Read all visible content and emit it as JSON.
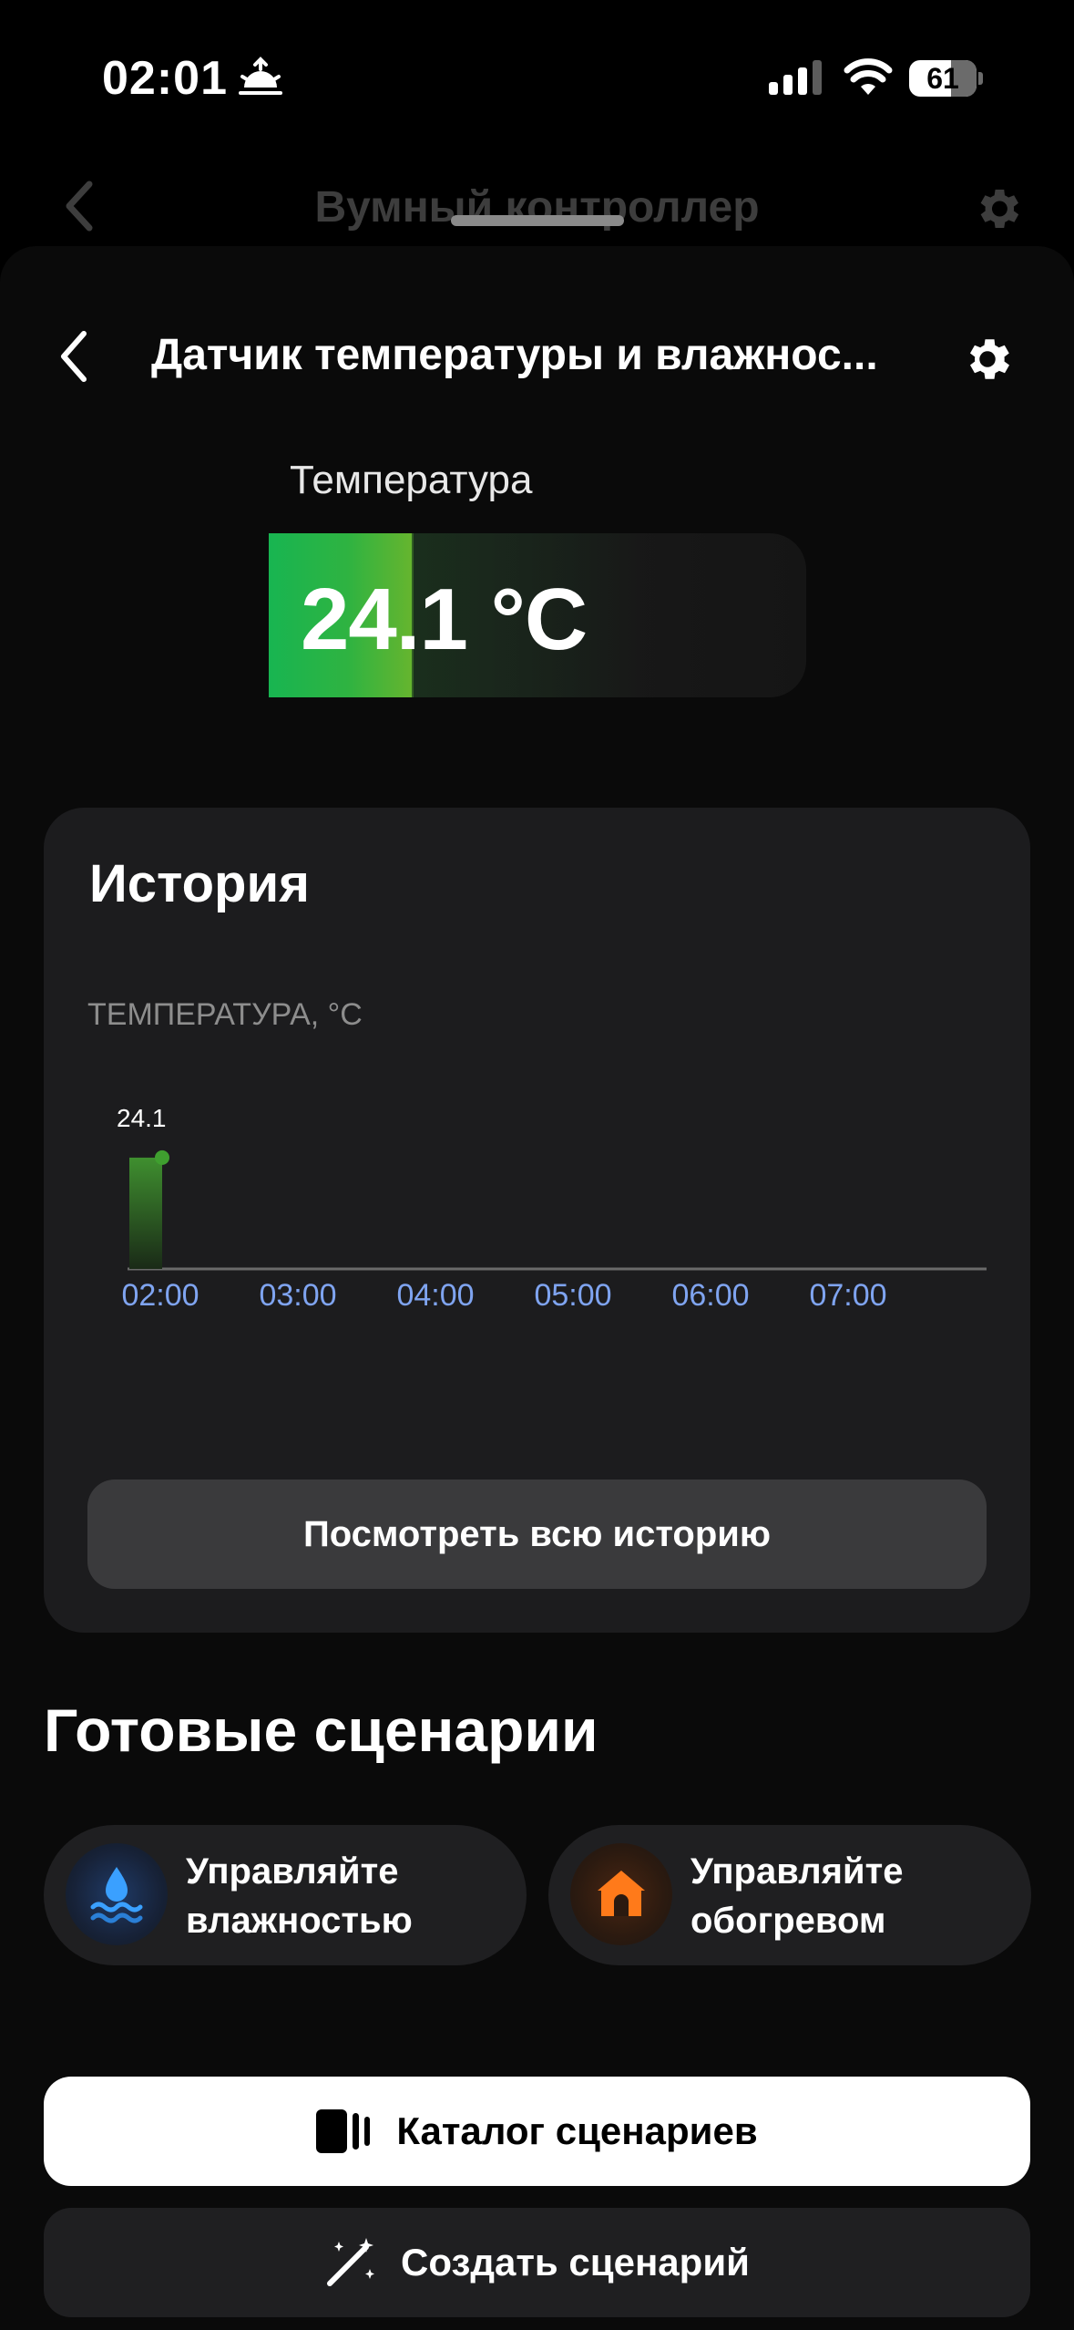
{
  "status_bar": {
    "time": "02:01",
    "battery": "61",
    "icons": [
      "sunrise-icon",
      "cellular-signal-icon",
      "wifi-icon",
      "battery-icon"
    ]
  },
  "background_header": {
    "title": "Вумный контроллер"
  },
  "header": {
    "title": "Датчик температуры и влажнос..."
  },
  "temperature": {
    "label": "Температура",
    "value": "24.1 °C",
    "level_fraction": 0.27,
    "accent": "#2fb341"
  },
  "history": {
    "title": "История",
    "button_label": "Посмотреть всю историю"
  },
  "chart_data": {
    "type": "bar",
    "ylabel": "ТЕМПЕРАТУРА, °C",
    "categories": [
      "02:00",
      "03:00",
      "04:00",
      "05:00",
      "06:00",
      "07:00"
    ],
    "values": [
      24.1,
      null,
      null,
      null,
      null,
      null
    ],
    "data_labels": [
      "24.1"
    ],
    "ylim": [
      0,
      30
    ],
    "color": "#3f8f2f"
  },
  "scenarios": {
    "title": "Готовые сценарии",
    "items": [
      {
        "line1": "Управляйте",
        "line2": "влажностью",
        "icon": "water-drop-icon",
        "color": "#3aa0ff"
      },
      {
        "line1": "Управляйте",
        "line2": "обогревом",
        "icon": "house-heat-icon",
        "color": "#ff7a1a"
      }
    ]
  },
  "actions": {
    "catalog_label": "Каталог сценариев",
    "create_label": "Создать сценарий"
  }
}
